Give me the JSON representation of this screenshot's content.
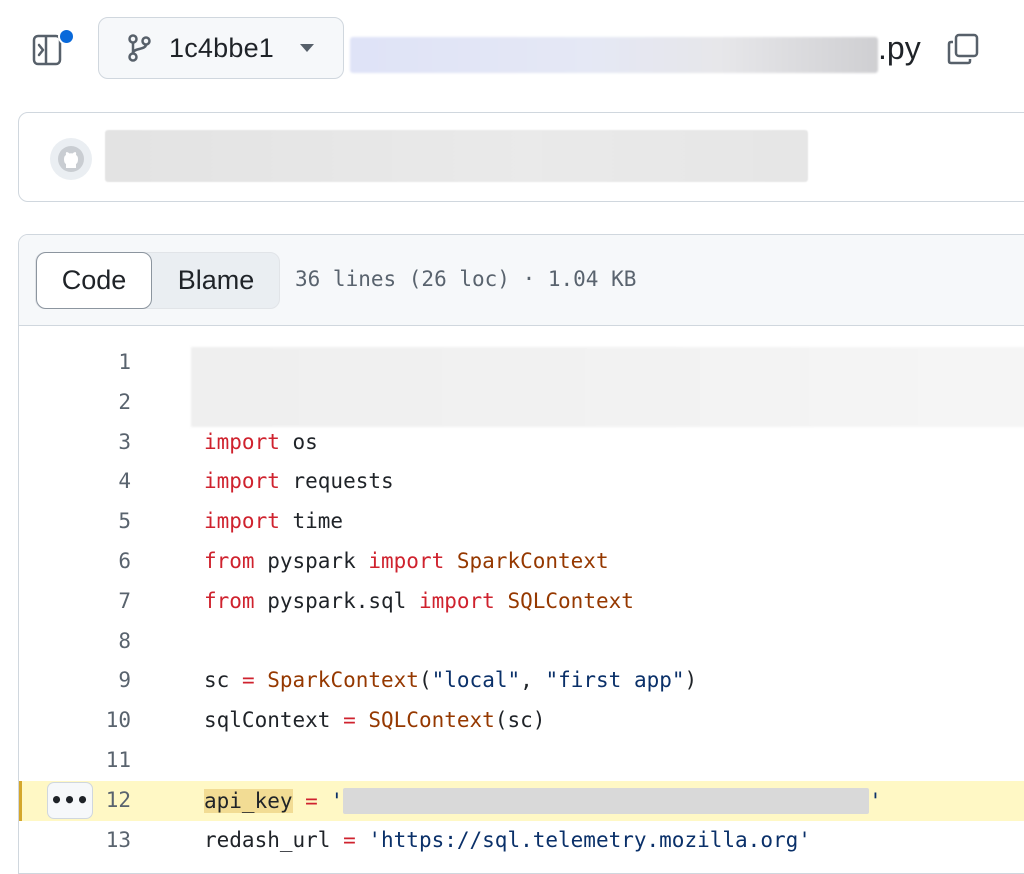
{
  "topbar": {
    "branch": "1c4bbe1",
    "file_ext": ".py"
  },
  "code_view": {
    "tabs": {
      "code": "Code",
      "blame": "Blame"
    },
    "file_meta": "36 lines (26 loc) · 1.04 KB"
  },
  "lines": {
    "n1": "1",
    "n2": "2",
    "n3": "3",
    "n4": "4",
    "n5": "5",
    "n6": "6",
    "n7": "7",
    "n8": "8",
    "n9": "9",
    "n10": "10",
    "n11": "11",
    "n12": "12",
    "n13": "13",
    "l3_kw": "import",
    "l3_rest": " os",
    "l4_kw": "import",
    "l4_rest": " requests",
    "l5_kw": "import",
    "l5_rest": " time",
    "l6_kw1": "from",
    "l6_mid": " pyspark ",
    "l6_kw2": "import",
    "l6_cls": " SparkContext",
    "l7_kw1": "from",
    "l7_mid": " pyspark.sql ",
    "l7_kw2": "import",
    "l7_cls": " SQLContext",
    "l9_a": "sc ",
    "l9_op": "=",
    "l9_cls": " SparkContext",
    "l9_p1": "(",
    "l9_s1": "\"local\"",
    "l9_c": ", ",
    "l9_s2": "\"first app\"",
    "l9_p2": ")",
    "l10_a": "sqlContext ",
    "l10_op": "=",
    "l10_cls": " SQLContext",
    "l10_rest": "(sc)",
    "l12_var": "api_key",
    "l12_op": " = ",
    "l12_q1": "'",
    "l12_q2": "'",
    "l13_var": "redash_url ",
    "l13_op": "=",
    "l13_str": " 'https://sql.telemetry.mozilla.org'"
  },
  "more_button": "•••",
  "icons": {
    "panel": "sidebar-toggle-icon",
    "branch": "git-branch-icon",
    "dropdown": "triangle-down-icon",
    "copy": "copy-icon",
    "avatar": "github-avatar-icon"
  },
  "colors": {
    "accent": "#0969da",
    "keyword": "#cf222e",
    "class": "#953800",
    "string": "#0a3069",
    "highlight": "#fff8c5"
  }
}
